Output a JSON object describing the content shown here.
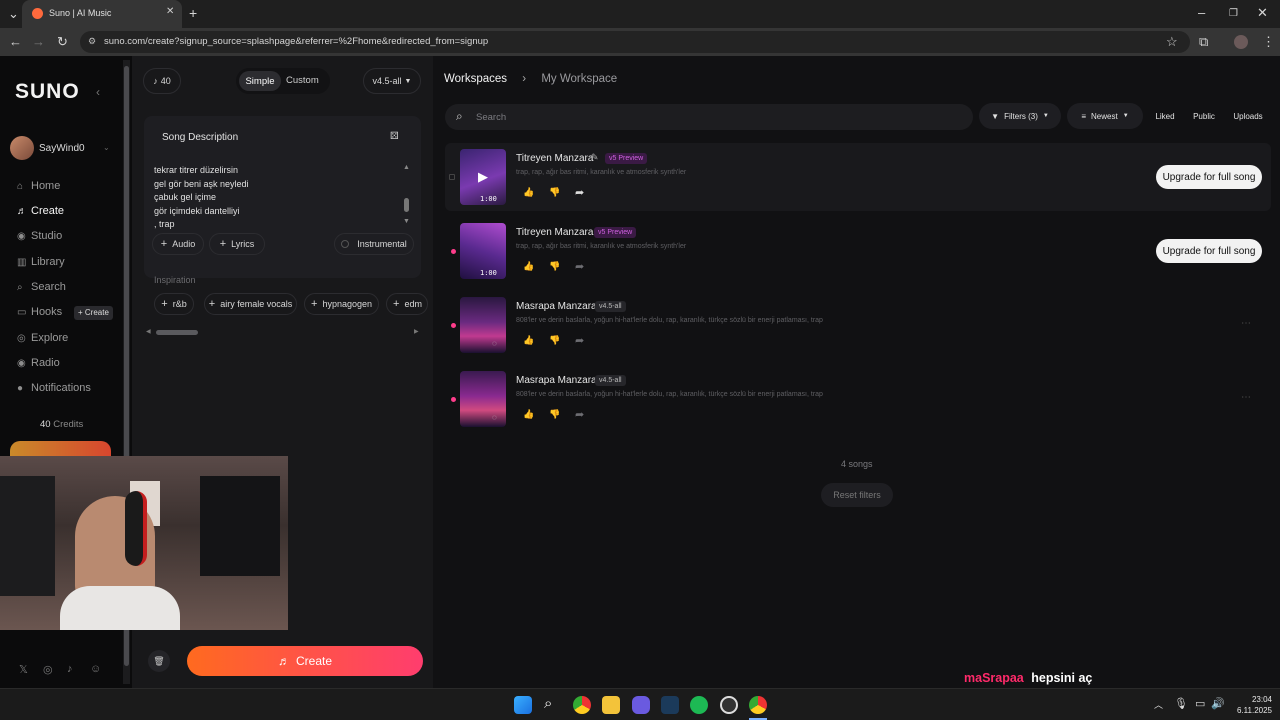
{
  "browser": {
    "tab_title": "Suno | AI Music",
    "url": "suno.com/create?signup_source=splashpage&referrer=%2Fhome&redirected_from=signup"
  },
  "sidebar": {
    "logo": "SUNO",
    "username": "SayWind0",
    "items": [
      {
        "label": "Home",
        "icon": "home-icon"
      },
      {
        "label": "Create",
        "icon": "create-icon"
      },
      {
        "label": "Studio",
        "icon": "studio-icon"
      },
      {
        "label": "Library",
        "icon": "library-icon"
      },
      {
        "label": "Search",
        "icon": "search-icon"
      },
      {
        "label": "Hooks",
        "icon": "hooks-icon"
      },
      {
        "label": "Explore",
        "icon": "explore-icon"
      },
      {
        "label": "Radio",
        "icon": "radio-icon"
      },
      {
        "label": "Notifications",
        "icon": "bell-icon"
      }
    ],
    "hooks_create": "+ Create",
    "credits": "40",
    "credits_label": "Credits"
  },
  "composer": {
    "credits_count": "40",
    "mode_simple": "Simple",
    "mode_custom": "Custom",
    "model": "v4.5-all",
    "song_description_label": "Song Description",
    "description_lines": [
      "tekrar titrer düzelirsin",
      "gel gör beni aşk neyledi",
      "çabuk gel içime",
      "gör içimdeki dantelliyi",
      ", trap"
    ],
    "audio_label": "Audio",
    "lyrics_label": "Lyrics",
    "instrumental_label": "Instrumental",
    "inspiration_label": "Inspiration",
    "inspiration_tags": [
      "r&b",
      "airy female vocals",
      "hypnagogen",
      "edm"
    ],
    "create_button": "Create"
  },
  "main": {
    "breadcrumb_root": "Workspaces",
    "breadcrumb_current": "My Workspace",
    "search_placeholder": "Search",
    "filters_label": "Filters (3)",
    "sort_label": "Newest",
    "liked": "Liked",
    "public": "Public",
    "uploads": "Uploads",
    "songs": [
      {
        "title": "Titreyen Manzara",
        "tag": "v5 Preview",
        "description": "trap, rap, ağır bas ritmi, karanlık ve atmosferik synth'ler",
        "duration": "1:00",
        "action": "Upgrade for full song"
      },
      {
        "title": "Titreyen Manzara",
        "tag": "v5 Preview",
        "description": "trap, rap, ağır bas ritmi, karanlık ve atmosferik synth'ler",
        "duration": "1:00",
        "action": "Upgrade for full song"
      },
      {
        "title": "Masrapa Manzara",
        "tag": "v4.5-all",
        "description": "808'ler ve derin baslarla, yoğun hi-hat'lerle dolu, rap, karanlık, türkçe sözlü bir enerji patlaması, trap",
        "duration": "",
        "action": ""
      },
      {
        "title": "Masrapa Manzara",
        "tag": "v4.5-all",
        "description": "808'ler ve derin baslarla, yoğun hi-hat'lerle dolu, rap, karanlık, türkçe sözlü bir enerji patlaması, trap",
        "duration": "",
        "action": ""
      }
    ],
    "song_count": "4 songs",
    "reset_filters": "Reset filters"
  },
  "overlay_caption": {
    "part1": "maSrapaa",
    "part2": "hepsini aç"
  },
  "taskbar": {
    "time": "23:04",
    "date": "6.11.2025"
  },
  "colors": {
    "accent_pink": "#ff3d8b",
    "create_gradient_start": "#ff5a2b",
    "create_gradient_end": "#ff2f7a",
    "v5_tag": "#b04dc7"
  }
}
